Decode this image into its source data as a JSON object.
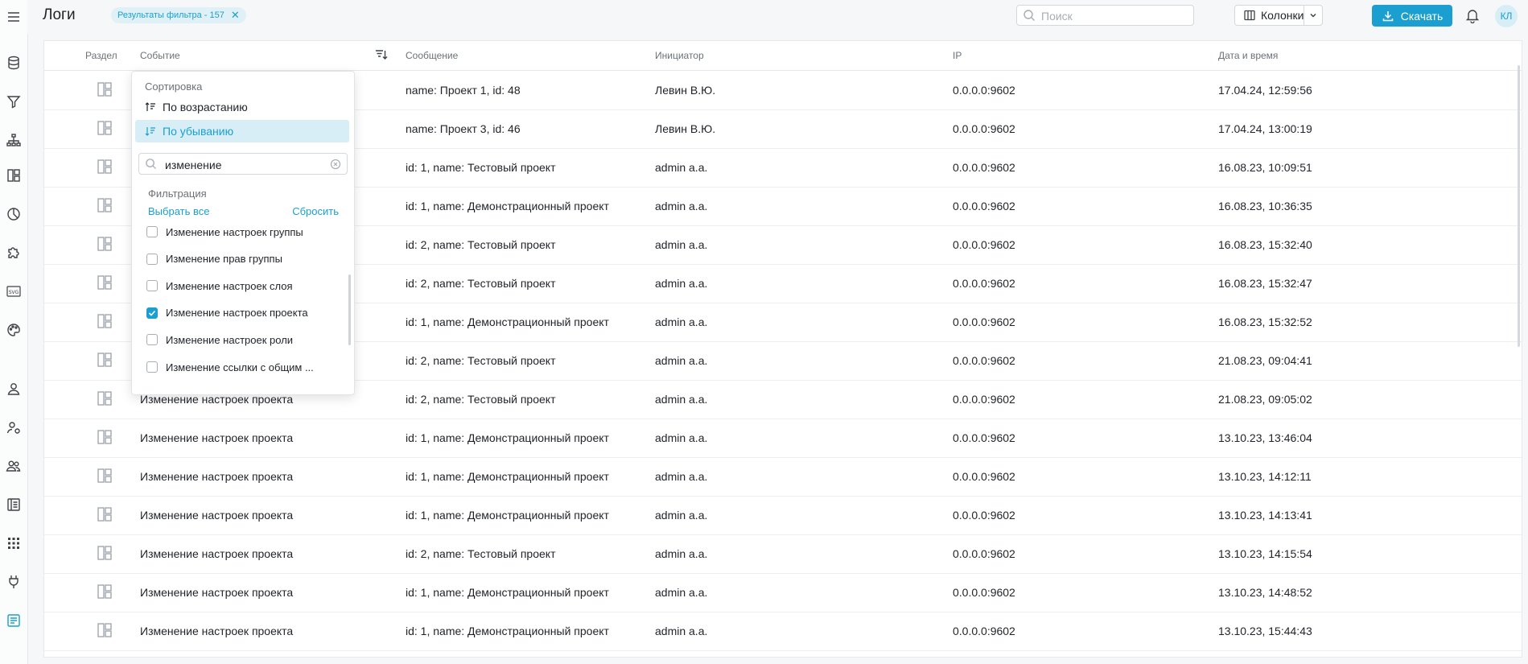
{
  "header": {
    "title": "Логи",
    "filter_chip": "Результаты фильтра - 157",
    "search_placeholder": "Поиск",
    "columns_label": "Колонки",
    "download_label": "Скачать",
    "avatar_initials": "КЛ"
  },
  "table": {
    "columns": [
      "Раздел",
      "Событие",
      "Сообщение",
      "Инициатор",
      "IP",
      "Дата и время"
    ],
    "rows": [
      {
        "event": "",
        "message": "name: Проект 1, id: 48",
        "initiator": "Левин В.Ю.",
        "ip": "0.0.0.0:9602",
        "datetime": "17.04.24, 12:59:56"
      },
      {
        "event": "",
        "message": "name: Проект 3, id: 46",
        "initiator": "Левин В.Ю.",
        "ip": "0.0.0.0:9602",
        "datetime": "17.04.24, 13:00:19"
      },
      {
        "event": "",
        "message": "id: 1, name: Тестовый проект",
        "initiator": "admin a.a.",
        "ip": "0.0.0.0:9602",
        "datetime": "16.08.23, 10:09:51"
      },
      {
        "event": "",
        "message": "id: 1, name: Демонстрационный проект",
        "initiator": "admin a.a.",
        "ip": "0.0.0.0:9602",
        "datetime": "16.08.23, 10:36:35"
      },
      {
        "event": "",
        "message": "id: 2, name: Тестовый проект",
        "initiator": "admin a.a.",
        "ip": "0.0.0.0:9602",
        "datetime": "16.08.23, 15:32:40"
      },
      {
        "event": "",
        "message": "id: 2, name: Тестовый проект",
        "initiator": "admin a.a.",
        "ip": "0.0.0.0:9602",
        "datetime": "16.08.23, 15:32:47"
      },
      {
        "event": "",
        "message": "id: 1, name: Демонстрационный проект",
        "initiator": "admin a.a.",
        "ip": "0.0.0.0:9602",
        "datetime": "16.08.23, 15:32:52"
      },
      {
        "event": "",
        "message": "id: 2, name: Тестовый проект",
        "initiator": "admin a.a.",
        "ip": "0.0.0.0:9602",
        "datetime": "21.08.23, 09:04:41"
      },
      {
        "event": "Изменение настроек проекта",
        "message": "id: 2, name: Тестовый проект",
        "initiator": "admin a.a.",
        "ip": "0.0.0.0:9602",
        "datetime": "21.08.23, 09:05:02"
      },
      {
        "event": "Изменение настроек проекта",
        "message": "id: 1, name: Демонстрационный проект",
        "initiator": "admin a.a.",
        "ip": "0.0.0.0:9602",
        "datetime": "13.10.23, 13:46:04"
      },
      {
        "event": "Изменение настроек проекта",
        "message": "id: 1, name: Демонстрационный проект",
        "initiator": "admin a.a.",
        "ip": "0.0.0.0:9602",
        "datetime": "13.10.23, 14:12:11"
      },
      {
        "event": "Изменение настроек проекта",
        "message": "id: 1, name: Демонстрационный проект",
        "initiator": "admin a.a.",
        "ip": "0.0.0.0:9602",
        "datetime": "13.10.23, 14:13:41"
      },
      {
        "event": "Изменение настроек проекта",
        "message": "id: 2, name: Тестовый проект",
        "initiator": "admin a.a.",
        "ip": "0.0.0.0:9602",
        "datetime": "13.10.23, 14:15:54"
      },
      {
        "event": "Изменение настроек проекта",
        "message": "id: 1, name: Демонстрационный проект",
        "initiator": "admin a.a.",
        "ip": "0.0.0.0:9602",
        "datetime": "13.10.23, 14:48:52"
      },
      {
        "event": "Изменение настроек проекта",
        "message": "id: 1, name: Демонстрационный проект",
        "initiator": "admin a.a.",
        "ip": "0.0.0.0:9602",
        "datetime": "13.10.23, 15:44:43"
      }
    ]
  },
  "dropdown": {
    "sort_heading": "Сортировка",
    "sort_asc": "По возрастанию",
    "sort_desc": "По убыванию",
    "search_value": "изменение",
    "filter_heading": "Фильтрация",
    "select_all": "Выбрать все",
    "reset": "Сбросить",
    "options": [
      {
        "label": "Изменение настроек группы",
        "checked": false
      },
      {
        "label": "Изменение прав группы",
        "checked": false
      },
      {
        "label": "Изменение настроек слоя",
        "checked": false
      },
      {
        "label": "Изменение настроек проекта",
        "checked": true
      },
      {
        "label": "Изменение настроек роли",
        "checked": false
      },
      {
        "label": "Изменение ссылки с общим ...",
        "checked": false
      }
    ]
  },
  "sidebar": {
    "icons": [
      "menu-icon",
      "database-icon",
      "filter-icon",
      "hierarchy-icon",
      "layout-icon",
      "pie-chart-icon",
      "puzzle-icon",
      "svg-icon",
      "palette-icon",
      "user-icon",
      "user-settings-icon",
      "users-icon",
      "book-icon",
      "apps-grid-icon",
      "plug-icon",
      "logs-icon"
    ]
  },
  "colors": {
    "accent": "#1a9fd0",
    "selected_bg": "#d7eef7"
  }
}
